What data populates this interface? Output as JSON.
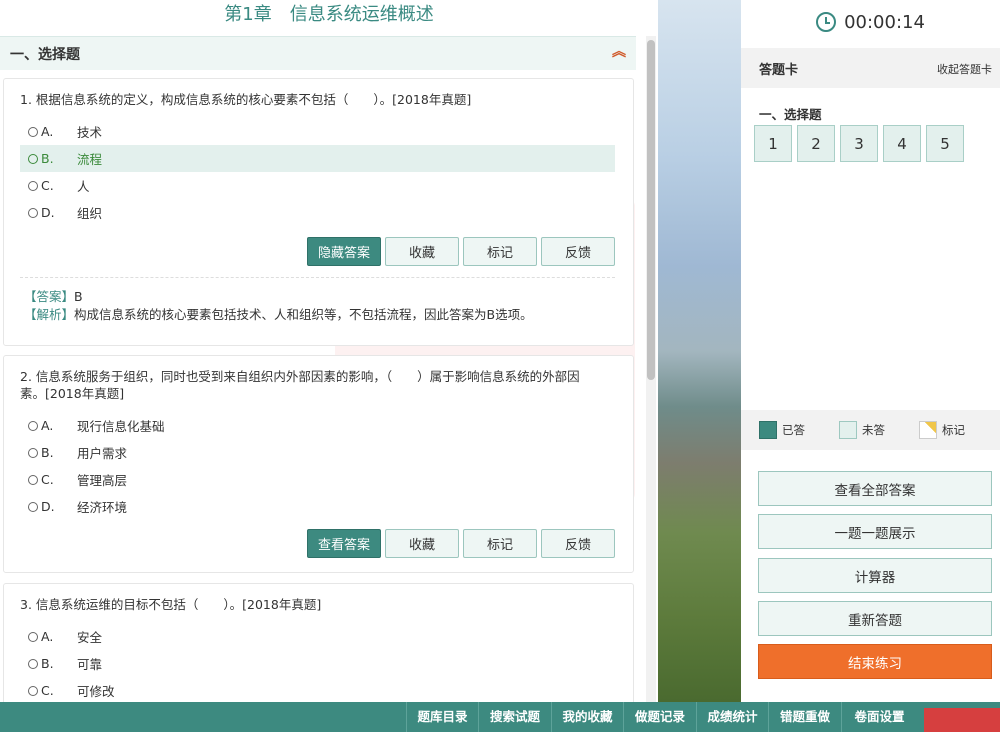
{
  "chapter_title": "第1章　信息系统运维概述",
  "section": {
    "label": "一、选择题",
    "collapse_icon": "double-chevron-up-icon"
  },
  "questions": [
    {
      "text": "1. 根据信息系统的定义，构成信息系统的核心要素不包括（　　）。[2018年真题]",
      "options": [
        {
          "letter": "A.",
          "text": "技术"
        },
        {
          "letter": "B.",
          "text": "流程"
        },
        {
          "letter": "C.",
          "text": "人"
        },
        {
          "letter": "D.",
          "text": "组织"
        }
      ],
      "selected": 1,
      "buttons": {
        "toggle_answer": "隐藏答案",
        "favorite": "收藏",
        "mark": "标记",
        "feedback": "反馈"
      },
      "answer_tag": "【答案】",
      "answer_value": "B",
      "analysis_tag": "【解析】",
      "analysis_text": "构成信息系统的核心要素包括技术、人和组织等，不包括流程，因此答案为B选项。"
    },
    {
      "text": "2. 信息系统服务于组织，同时也受到来自组织内外部因素的影响，（　　）属于影响信息系统的外部因素。[2018年真题]",
      "options": [
        {
          "letter": "A.",
          "text": "现行信息化基础"
        },
        {
          "letter": "B.",
          "text": "用户需求"
        },
        {
          "letter": "C.",
          "text": "管理高层"
        },
        {
          "letter": "D.",
          "text": "经济环境"
        }
      ],
      "buttons": {
        "toggle_answer": "查看答案",
        "favorite": "收藏",
        "mark": "标记",
        "feedback": "反馈"
      }
    },
    {
      "text": "3. 信息系统运维的目标不包括（　　）。[2018年真题]",
      "options": [
        {
          "letter": "A.",
          "text": "安全"
        },
        {
          "letter": "B.",
          "text": "可靠"
        },
        {
          "letter": "C.",
          "text": "可修改"
        }
      ]
    }
  ],
  "side": {
    "timer": "00:00:14",
    "timer_icon": "clock-icon",
    "card_title": "答题卡",
    "collapse_card": "收起答题卡",
    "section_label": "一、选择题",
    "numbers": [
      "1",
      "2",
      "3",
      "4",
      "5"
    ],
    "legend": {
      "answered": "已答",
      "unanswered": "未答",
      "marked": "标记"
    },
    "buttons": {
      "view_all": "查看全部答案",
      "one_by_one": "一题一题展示",
      "calculator": "计算器",
      "redo": "重新答题",
      "finish": "结束练习"
    }
  },
  "bottombar": [
    "题库目录",
    "搜索试题",
    "我的收藏",
    "做题记录",
    "成绩统计",
    "错题重做",
    "卷面设置"
  ],
  "colors": {
    "accent": "#3d8a80",
    "finish": "#ef6f2b",
    "toolbar": "#3d8a80",
    "selected_option": "#3b8a3b"
  }
}
